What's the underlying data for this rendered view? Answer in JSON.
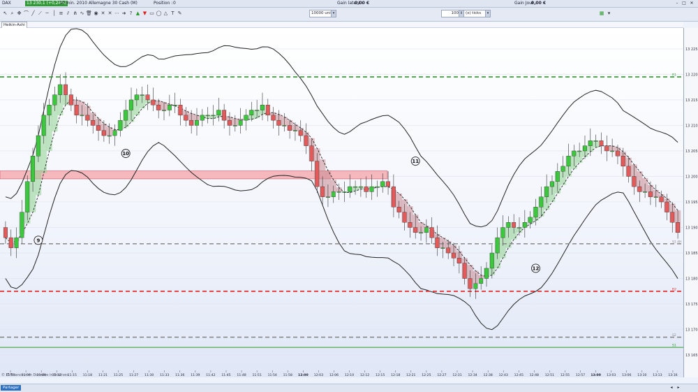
{
  "titlebar": {
    "symbol": "DAX",
    "price_badge": "13 230,1 (+0,24%)",
    "instrument": "10 min. 2010 Allemagne 30 Cash (M)",
    "position_label": "Position :",
    "position_value": "0",
    "gain_latent_label": "Gain latent :",
    "gain_latent_value": "0,00 €",
    "gain_jour_label": "Gain Jour :",
    "gain_jour_value": "0,00 €"
  },
  "toolbar": {
    "units_value": "10000 unités",
    "qty_value": "100",
    "period_value": "(x) ticks"
  },
  "indicator_strip": {
    "label": "Heikin-Ashi"
  },
  "statusbar": {
    "share_label": "Partager"
  },
  "credit": "© IT-Finance.com  Données indicatives",
  "chart_data": {
    "type": "candlestick",
    "ylim": [
      13162,
      13228
    ],
    "y_ticks": [
      13165,
      13170,
      13175,
      13180,
      13185,
      13190,
      13195,
      13200,
      13205,
      13210,
      13215,
      13220,
      13225
    ],
    "y_tick_labels": [
      "13 165",
      "13 170",
      "13 175",
      "13 180",
      "13 185",
      "13 190",
      "13 195",
      "13 200",
      "13 205",
      "13 210",
      "13 215",
      "13 220",
      "13 225"
    ],
    "x_tick_labels": [
      "11:03",
      "11:06",
      "11:09",
      "11:12",
      "11:15",
      "11:18",
      "11:21",
      "11:25",
      "11:27",
      "11:30",
      "11:33",
      "11:36",
      "11:39",
      "11:42",
      "11:45",
      "11:48",
      "11:51",
      "11:54",
      "11:58",
      "12:00",
      "12:03",
      "12:06",
      "12:10",
      "12:12",
      "12:15",
      "12:18",
      "12:21",
      "12:25",
      "12:27",
      "12:31",
      "12:34",
      "12:38",
      "12:43",
      "12:45",
      "12:48",
      "12:51",
      "12:55",
      "12:57",
      "13:00",
      "13:03",
      "13:06",
      "13:10",
      "13:13",
      "13:16"
    ],
    "x_tick_bold": [
      "12:00",
      "13:00"
    ],
    "series_bullish_color": "#3cc83c",
    "series_bearish_color": "#e25a5a",
    "close": [
      13188,
      13186,
      13188,
      13193,
      13199,
      13204,
      13208,
      13212,
      13214,
      13216,
      13218,
      13216,
      13214,
      13212,
      13212,
      13211,
      13210,
      13209,
      13208,
      13208,
      13209,
      13211,
      13213,
      13215,
      13216,
      13216,
      13215,
      13214,
      13213,
      13213,
      13214,
      13214,
      13212,
      13211,
      13210,
      13211,
      13212,
      13212,
      13212,
      13213,
      13211,
      13210,
      13210,
      13211,
      13212,
      13213,
      13213,
      13214,
      13212,
      13211,
      13210,
      13210,
      13209,
      13209,
      13208,
      13206,
      13203,
      13198,
      13196,
      13196,
      13197,
      13197,
      13197,
      13198,
      13198,
      13198,
      13197,
      13198,
      13198,
      13199,
      13198,
      13194,
      13193,
      13191,
      13190,
      13189,
      13189,
      13190,
      13188,
      13186,
      13186,
      13185,
      13184,
      13183,
      13180,
      13178,
      13179,
      13180,
      13182,
      13185,
      13188,
      13190,
      13191,
      13190,
      13190,
      13191,
      13192,
      13194,
      13196,
      13198,
      13199,
      13201,
      13202,
      13204,
      13205,
      13205,
      13206,
      13207,
      13207,
      13206,
      13205,
      13205,
      13204,
      13202,
      13200,
      13198,
      13197,
      13197,
      13196,
      13196,
      13195,
      13193,
      13191,
      13189
    ],
    "open": [
      13190,
      13188,
      13186,
      13188,
      13193,
      13199,
      13204,
      13208,
      13212,
      13214,
      13216,
      13218,
      13216,
      13214,
      13212,
      13212,
      13211,
      13210,
      13209,
      13208,
      13208,
      13209,
      13211,
      13213,
      13215,
      13216,
      13216,
      13215,
      13214,
      13213,
      13213,
      13214,
      13214,
      13212,
      13211,
      13210,
      13211,
      13212,
      13212,
      13212,
      13213,
      13211,
      13210,
      13210,
      13211,
      13212,
      13213,
      13213,
      13214,
      13212,
      13211,
      13210,
      13210,
      13209,
      13209,
      13208,
      13206,
      13203,
      13198,
      13196,
      13196,
      13197,
      13197,
      13197,
      13198,
      13198,
      13198,
      13197,
      13198,
      13198,
      13199,
      13198,
      13194,
      13193,
      13191,
      13190,
      13189,
      13189,
      13190,
      13188,
      13186,
      13186,
      13185,
      13184,
      13183,
      13180,
      13178,
      13179,
      13180,
      13182,
      13185,
      13188,
      13190,
      13191,
      13190,
      13190,
      13191,
      13192,
      13194,
      13196,
      13198,
      13199,
      13201,
      13202,
      13204,
      13205,
      13205,
      13206,
      13207,
      13207,
      13206,
      13205,
      13205,
      13204,
      13202,
      13200,
      13198,
      13197,
      13197,
      13196,
      13196,
      13195,
      13193,
      13191
    ],
    "ema_upper_levels": [
      {
        "label": "R1",
        "value": 13219.5,
        "color": "#2a9a2a",
        "style": "dashed"
      },
      {
        "label": "R2",
        "value": 13177.5,
        "color": "#e02020",
        "style": "dashed"
      },
      {
        "label": "S1",
        "value": 13166.5,
        "color": "#2a9a2a",
        "style": "solid"
      },
      {
        "label": "S2",
        "value": 13168.5,
        "color": "#888888",
        "style": "dashed"
      },
      {
        "label": "S1 4H",
        "value": 13186.8,
        "color": "#888888",
        "style": "dashed"
      }
    ],
    "highlight_band": {
      "from": 13199.8,
      "to": 13200.8,
      "color": "#f4b8bd"
    },
    "wave_labels": [
      {
        "text": "9",
        "x_index": 6,
        "value": 13187.5
      },
      {
        "text": "10",
        "x_index": 22,
        "value": 13204.5
      },
      {
        "text": "11",
        "x_index": 75,
        "value": 13203
      },
      {
        "text": "12",
        "x_index": 97,
        "value": 13182
      }
    ],
    "right_price_tags": [
      "13 224,1",
      "13 213,5",
      "13 210,3",
      "13 200",
      "13 197,5",
      "13 180,2",
      "13 176,8"
    ]
  }
}
